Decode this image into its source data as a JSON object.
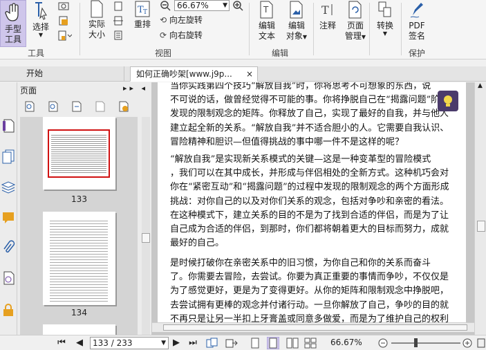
{
  "ribbon": {
    "hand": {
      "line1": "手型",
      "line2": "工具"
    },
    "select": {
      "label": "选择"
    },
    "actual_size": {
      "line1": "实际",
      "line2": "大小"
    },
    "reflow": {
      "label": "重排"
    },
    "zoom": {
      "value": "66.67%"
    },
    "rotate_left": "向左旋转",
    "rotate_right": "向右旋转",
    "edit_text": {
      "line1": "编辑",
      "line2": "文本"
    },
    "edit_object": {
      "line1": "编辑",
      "line2": "对象"
    },
    "annotate": {
      "label": "注释"
    },
    "page_manage": {
      "line1": "页面",
      "line2": "管理"
    },
    "convert": {
      "label": "转换"
    },
    "pdf_sign": {
      "line1": "PDF",
      "line2": "签名"
    },
    "groups": {
      "tools": "工具",
      "view": "视图",
      "edit": "编辑",
      "protect": "保护"
    }
  },
  "tabs": {
    "home": "开始",
    "doc": "如何正确吵架[www.j9p...",
    "close": "×"
  },
  "panel": {
    "title": "页面",
    "arrows": "▸▸ ◂"
  },
  "thumbs": [
    {
      "label": "133"
    },
    {
      "label": "134"
    }
  ],
  "document": {
    "paragraphs": [
      {
        "lines": [
          "当你实践第四个技巧“解放自我”时，你将思考不可想象的东西，说",
          "不可说的话，做曾经觉得不可能的事。你将挣脱自己在“揭露问题”阶段",
          "发现的限制观念的矩阵。你释放了自己，实现了最好的自我，并与他人",
          "建立起全新的关系。“解放自我”并不适合胆小的人。它需要自我认识、",
          "冒险精神和胆识—但值得挑战的事中哪一件不是这样的呢？"
        ]
      },
      {
        "lines": [
          "“解放自我”是实现新关系模式的关键—这是一种变革型的冒险模式",
          "，我们可以在其中成长，并形成与伴侣相处的全新方式。这种机巧会对",
          "你在“紧密互动”和“揭露问题”的过程中发现的限制观念的两个方面形成",
          "挑战：对你自己的以及对你们关系的观念，包括对争吵和亲密的看法。",
          "在这种模式下，建立关系的目的不是为了找到合适的伴侣，而是为了让",
          "自己成为合适的伴侣，到那时，你们都将朝着更大的目标而努力，成就",
          "最好的自己。"
        ]
      },
      {
        "lines": [
          "是时候打破你在亲密关系中的旧习惯，为你自己和你的关系而奋斗",
          "了。你需要去冒险，去尝试。你要为真正重要的事情而争吵，不仅仅是",
          "为了感觉更好，更是为了变得更好。从你的矩阵和限制观念中挣脱吧，",
          "去尝试拥有更棒的观念并付诸行动。一旦你解放了自己，争吵的目的就",
          "不再只是让另一半扣上牙膏盖或同意多做爱，而是为了维护自己的权利"
        ]
      }
    ]
  },
  "status": {
    "page": "133 / 233",
    "zoom": "66.67%"
  }
}
